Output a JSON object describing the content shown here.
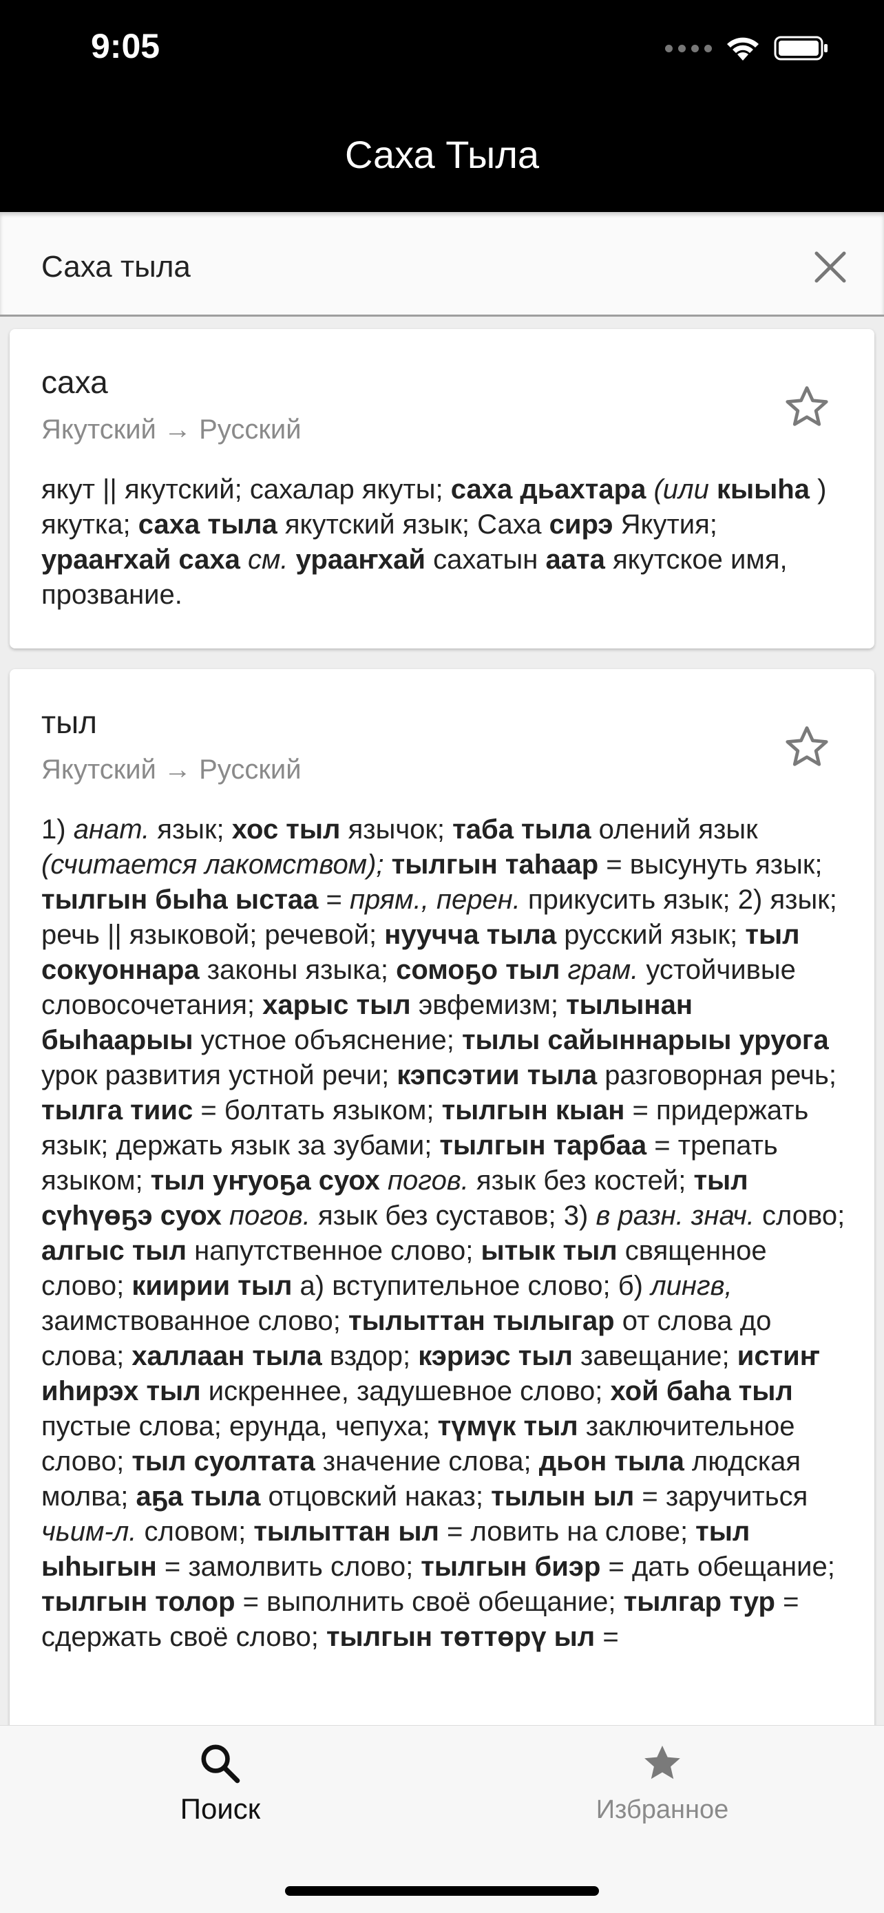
{
  "status": {
    "time": "9:05"
  },
  "header": {
    "title": "Саха Тыла"
  },
  "search": {
    "value": "Саха тыла",
    "clear_icon": "close-icon"
  },
  "entries": [
    {
      "headword": "саха",
      "direction": "Якутский → Русский",
      "favorite_icon": "star-outline-icon",
      "definition": [
        {
          "t": "якут || якутский; сахалар якуты; "
        },
        {
          "t": "саха дьахтара",
          "s": "b"
        },
        {
          "t": " "
        },
        {
          "t": "(или",
          "s": "i"
        },
        {
          "t": " "
        },
        {
          "t": "кыыһа",
          "s": "b"
        },
        {
          "t": " ) якутка; "
        },
        {
          "t": "саха тыла",
          "s": "b"
        },
        {
          "t": " якутский язык; Саха "
        },
        {
          "t": "сирэ",
          "s": "b"
        },
        {
          "t": " Якутия; "
        },
        {
          "t": "урааҥхай саха",
          "s": "b"
        },
        {
          "t": " "
        },
        {
          "t": "см.",
          "s": "i"
        },
        {
          "t": " "
        },
        {
          "t": "урааҥхай",
          "s": "b"
        },
        {
          "t": " сахатын "
        },
        {
          "t": "аата",
          "s": "b"
        },
        {
          "t": " якутское имя, прозвание."
        }
      ]
    },
    {
      "headword": "тыл",
      "direction": "Якутский → Русский",
      "favorite_icon": "star-outline-icon",
      "definition": [
        {
          "t": "1) "
        },
        {
          "t": "анат.",
          "s": "i"
        },
        {
          "t": " язык; "
        },
        {
          "t": "хос тыл",
          "s": "b"
        },
        {
          "t": " язычок; "
        },
        {
          "t": "таба тыла",
          "s": "b"
        },
        {
          "t": " олений язык "
        },
        {
          "t": "(считается лакомством);",
          "s": "i"
        },
        {
          "t": " "
        },
        {
          "t": "тылгын таһаар",
          "s": "b"
        },
        {
          "t": " = высунуть язык; "
        },
        {
          "t": "тылгын быһа ыстаа",
          "s": "b"
        },
        {
          "t": " = "
        },
        {
          "t": "прям., перен.",
          "s": "i"
        },
        {
          "t": " прикусить язык; 2) язык; речь || языковой; речевой; "
        },
        {
          "t": "нуучча тыла",
          "s": "b"
        },
        {
          "t": " русский язык; "
        },
        {
          "t": "тыл сокуоннара",
          "s": "b"
        },
        {
          "t": " законы языка; "
        },
        {
          "t": "сомоҕо тыл",
          "s": "b"
        },
        {
          "t": " "
        },
        {
          "t": "грам.",
          "s": "i"
        },
        {
          "t": " устойчивые словосочетания; "
        },
        {
          "t": "харыс тыл",
          "s": "b"
        },
        {
          "t": " эвфемизм; "
        },
        {
          "t": "тылынан быһаарыы",
          "s": "b"
        },
        {
          "t": " устное объяснение; "
        },
        {
          "t": "тылы сайыннарыы уруога",
          "s": "b"
        },
        {
          "t": " урок развития устной речи; "
        },
        {
          "t": "кэпсэтии тыла",
          "s": "b"
        },
        {
          "t": " разговорная речь; "
        },
        {
          "t": "тылга тиис",
          "s": "b"
        },
        {
          "t": " = болтать языком; "
        },
        {
          "t": "тылгын кыан",
          "s": "b"
        },
        {
          "t": " = придержать язык; держать язык за зубами; "
        },
        {
          "t": "тылгын тарбаа",
          "s": "b"
        },
        {
          "t": " = трепать языком; "
        },
        {
          "t": "тыл уҥуоҕа суох",
          "s": "b"
        },
        {
          "t": " "
        },
        {
          "t": "погов.",
          "s": "i"
        },
        {
          "t": " язык без костей; "
        },
        {
          "t": "тыл сүһүөҕэ суох",
          "s": "b"
        },
        {
          "t": " "
        },
        {
          "t": "погов.",
          "s": "i"
        },
        {
          "t": " язык без суставов; 3) "
        },
        {
          "t": "в разн. знач.",
          "s": "i"
        },
        {
          "t": " слово; "
        },
        {
          "t": "алгыс тыл",
          "s": "b"
        },
        {
          "t": " напутственное слово; "
        },
        {
          "t": "ытык тыл",
          "s": "b"
        },
        {
          "t": " священное слово; "
        },
        {
          "t": "киирии тыл",
          "s": "b"
        },
        {
          "t": " а) вступительное слово; б) "
        },
        {
          "t": "лингв,",
          "s": "i"
        },
        {
          "t": " заимствованное слово; "
        },
        {
          "t": "тылыттан тылыгар",
          "s": "b"
        },
        {
          "t": " от слова до слова; "
        },
        {
          "t": "халлаан тыла",
          "s": "b"
        },
        {
          "t": " вздор; "
        },
        {
          "t": "кэриэс тыл",
          "s": "b"
        },
        {
          "t": " завещание; "
        },
        {
          "t": "истиҥ иһирэх тыл",
          "s": "b"
        },
        {
          "t": " искреннее, задушевное слово; "
        },
        {
          "t": "хой баһа тыл",
          "s": "b"
        },
        {
          "t": " пустые слова; ерунда, чепуха; "
        },
        {
          "t": "түмүк тыл",
          "s": "b"
        },
        {
          "t": " заключительное слово; "
        },
        {
          "t": "тыл суолтата",
          "s": "b"
        },
        {
          "t": " значение слова; "
        },
        {
          "t": "дьон тыла",
          "s": "b"
        },
        {
          "t": " людская молва; "
        },
        {
          "t": "аҕа тыла",
          "s": "b"
        },
        {
          "t": " отцовский наказ; "
        },
        {
          "t": "тылын ыл",
          "s": "b"
        },
        {
          "t": " = заручиться "
        },
        {
          "t": "чьим-л.",
          "s": "i"
        },
        {
          "t": " словом; "
        },
        {
          "t": "тылыттан ыл",
          "s": "b"
        },
        {
          "t": " = ловить на слове; "
        },
        {
          "t": "тыл ыһыгын",
          "s": "b"
        },
        {
          "t": " = замолвить слово; "
        },
        {
          "t": "тылгын биэр",
          "s": "b"
        },
        {
          "t": " = дать обещание; "
        },
        {
          "t": "тылгын толор",
          "s": "b"
        },
        {
          "t": " = выполнить своё обещание; "
        },
        {
          "t": "тылгар тур",
          "s": "b"
        },
        {
          "t": " = сдержать своё слово; "
        },
        {
          "t": "тылгын төттөрү ыл",
          "s": "b"
        },
        {
          "t": " ="
        }
      ]
    }
  ],
  "tabs": {
    "search": {
      "label": "Поиск",
      "icon": "search-icon",
      "active": true
    },
    "favorites": {
      "label": "Избранное",
      "icon": "star-filled-icon",
      "active": false
    }
  },
  "colors": {
    "topbar": "#000000",
    "background": "#eeeeee",
    "card": "#ffffff",
    "muted": "#8a8a8a"
  }
}
